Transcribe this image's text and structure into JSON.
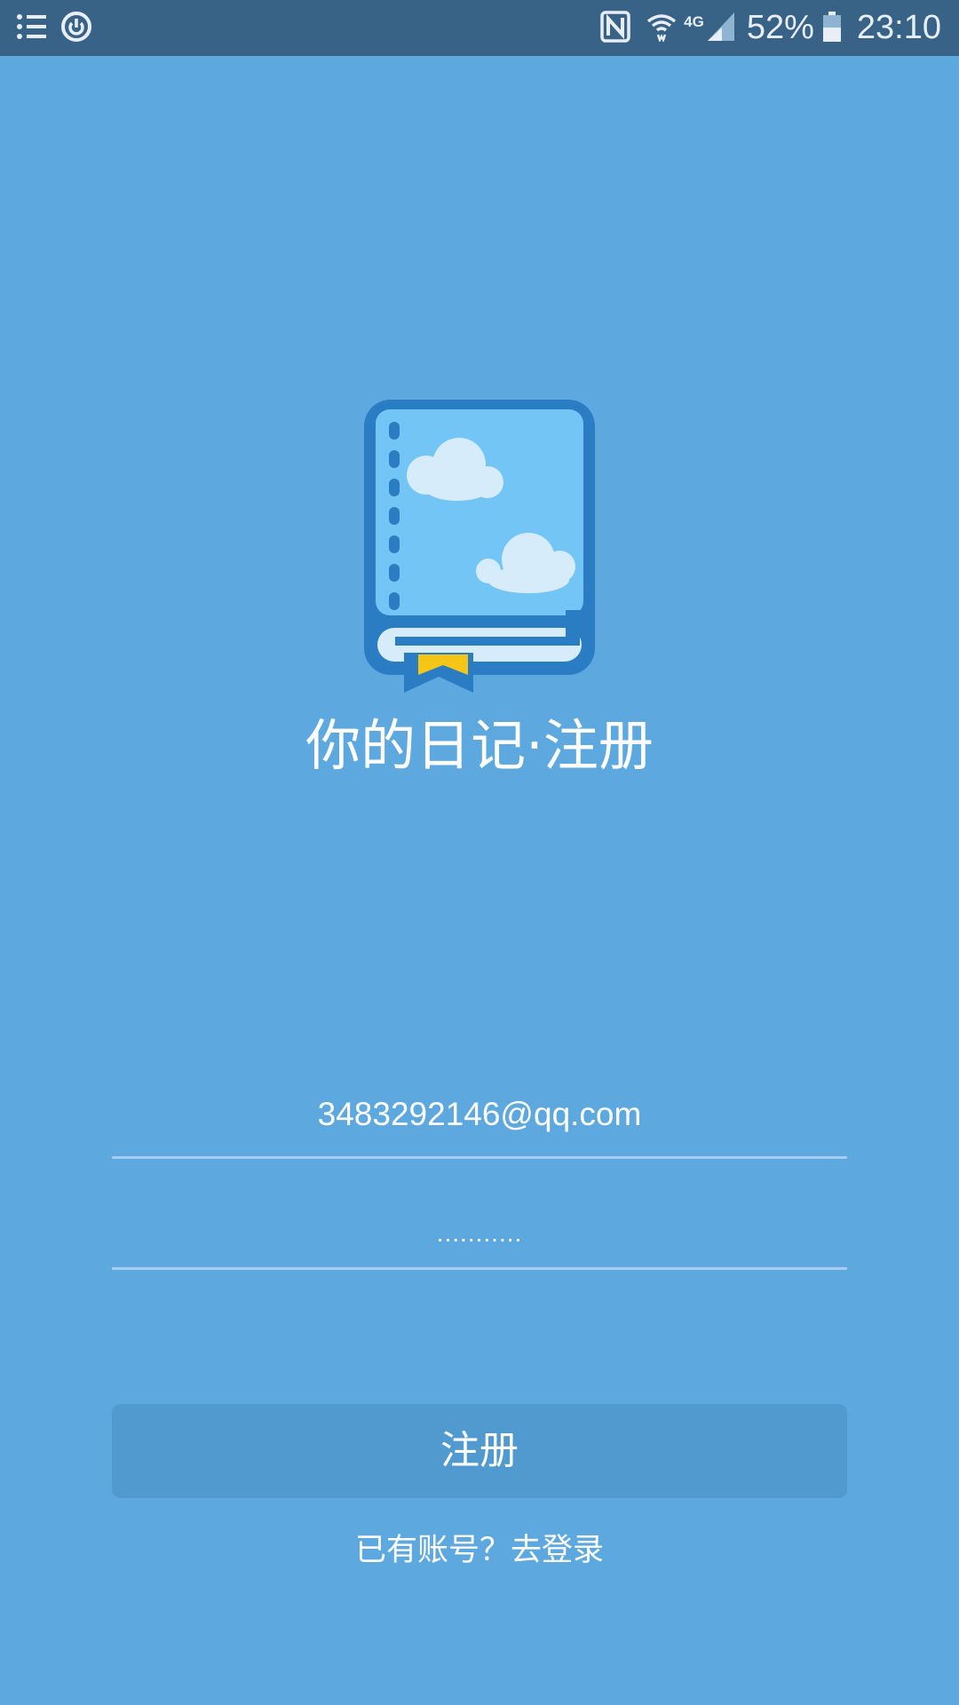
{
  "status_bar": {
    "battery": "52%",
    "time": "23:10",
    "network": "4G",
    "icons": [
      "list-icon",
      "power-saving-icon",
      "nfc-icon",
      "wifi-icon",
      "signal-icon",
      "battery-icon"
    ]
  },
  "app": {
    "title": "你的日记·注册",
    "logo": "diary-book-icon"
  },
  "form": {
    "email_value": "3483292146@qq.com",
    "password_value": "...........",
    "register_button_label": "注册",
    "login_link_label": "已有账号？去登录"
  },
  "colors": {
    "background": "#5ea8e0",
    "status_bar": "#386386",
    "button": "#519acf",
    "field_underline": "#a6cdf1",
    "bookmark": "#f5c518"
  }
}
